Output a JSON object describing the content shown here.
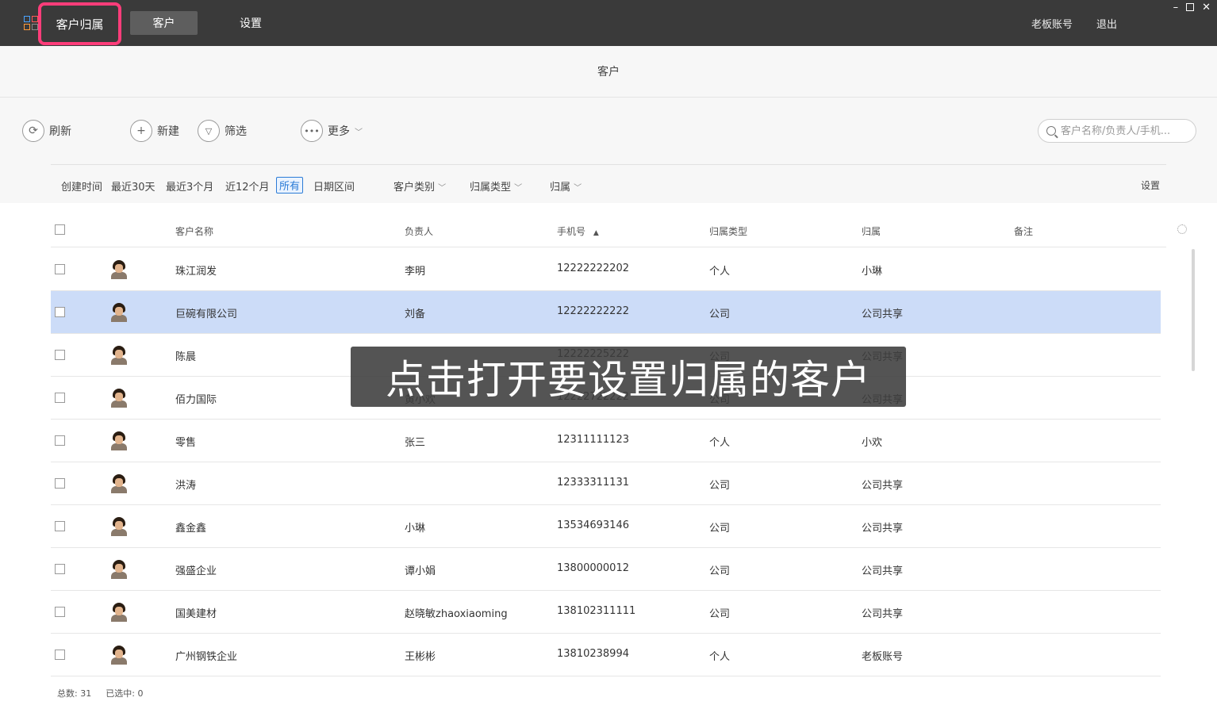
{
  "topbar": {
    "app_title": "客户归属",
    "tabs": [
      {
        "label": "客户",
        "active": true
      },
      {
        "label": "设置",
        "active": false
      }
    ],
    "account": "老板账号",
    "logout": "退出"
  },
  "page": {
    "title": "客户"
  },
  "toolbar": {
    "refresh": "刷新",
    "new": "新建",
    "filter": "筛选",
    "more": "更多",
    "search_placeholder": "客户名称/负责人/手机..."
  },
  "filters": {
    "created_label": "创建时间",
    "ranges": [
      "最近30天",
      "最近3个月",
      "近12个月",
      "所有",
      "日期区间"
    ],
    "selected_range": "所有",
    "category": "客户类别",
    "owner_type": "归属类型",
    "owner": "归属",
    "settings": "设置"
  },
  "table": {
    "columns": [
      "客户名称",
      "负责人",
      "手机号",
      "归属类型",
      "归属",
      "备注"
    ],
    "sort_indicator": "▲",
    "rows": [
      {
        "name": "珠江润发",
        "manager": "李明",
        "phone": "12222222202",
        "type": "个人",
        "owner": "小琳",
        "note": ""
      },
      {
        "name": "巨碗有限公司",
        "manager": "刘备",
        "phone": "12222222222",
        "type": "公司",
        "owner": "公司共享",
        "note": "",
        "highlighted": true
      },
      {
        "name": "陈晨",
        "manager": "",
        "phone": "12222225222",
        "type": "公司",
        "owner": "公司共享",
        "note": ""
      },
      {
        "name": "佰力国际",
        "manager": "黄小欢",
        "phone": "12222722222",
        "type": "公司",
        "owner": "公司共享",
        "note": ""
      },
      {
        "name": "零售",
        "manager": "张三",
        "phone": "12311111123",
        "type": "个人",
        "owner": "小欢",
        "note": ""
      },
      {
        "name": "洪涛",
        "manager": "",
        "phone": "12333311131",
        "type": "公司",
        "owner": "公司共享",
        "note": ""
      },
      {
        "name": "鑫金鑫",
        "manager": "小琳",
        "phone": "13534693146",
        "type": "公司",
        "owner": "公司共享",
        "note": ""
      },
      {
        "name": "强盛企业",
        "manager": "谭小娟",
        "phone": "13800000012",
        "type": "公司",
        "owner": "公司共享",
        "note": ""
      },
      {
        "name": "国美建材",
        "manager": "赵晓敏zhaoxiaoming",
        "phone": "138102311111",
        "type": "公司",
        "owner": "公司共享",
        "note": ""
      },
      {
        "name": "广州钢铁企业",
        "manager": "王彬彬",
        "phone": "13810238994",
        "type": "个人",
        "owner": "老板账号",
        "note": ""
      }
    ]
  },
  "footer": {
    "total_label": "总数:",
    "total": "31",
    "selected_label": "已选中:",
    "selected": "0"
  },
  "overlay": {
    "caption": "点击打开要设置归属的客户"
  },
  "colors": {
    "topbar": "#3a3a3a",
    "highlight_ring": "#ff3d7a",
    "selected_row": "#ccdcf8",
    "accent": "#2b7bd6"
  }
}
